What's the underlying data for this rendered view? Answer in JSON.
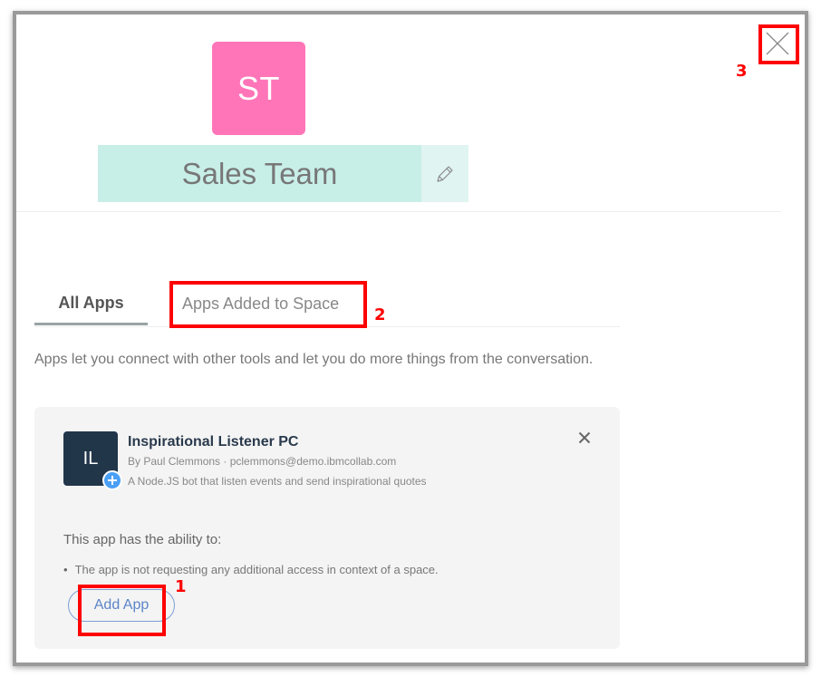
{
  "space": {
    "avatar_initials": "ST",
    "avatar_color": "#ff75b8",
    "name": "Sales Team",
    "name_field_color": "#c8eee8"
  },
  "header": {
    "edit_icon": "pencil-icon",
    "close_icon": "close-icon"
  },
  "tabs": [
    {
      "label": "All Apps",
      "active": true
    },
    {
      "label": "Apps Added to Space",
      "active": false
    }
  ],
  "intro_text": "Apps let you connect with other tools and let you do more things from the conversation.",
  "app_card": {
    "icon_initials": "IL",
    "icon_color": "#22364a",
    "badge_icon": "plus-icon",
    "badge_color": "#4a9ff5",
    "title": "Inspirational Listener PC",
    "author": "By Paul Clemmons · pclemmons@demo.ibmcollab.com",
    "description": "A Node.JS bot that listen events and send inspirational quotes",
    "dismiss_icon": "close-icon",
    "ability_heading": "This app has the ability to:",
    "abilities": [
      "The app is not requesting any additional access in context of a space."
    ],
    "add_button_label": "Add App",
    "accent_color": "#5b85c7"
  },
  "annotations": [
    {
      "number": "1",
      "target": "Add App"
    },
    {
      "number": "2",
      "target": "Apps Added to Space"
    },
    {
      "number": "3",
      "target": "close"
    }
  ]
}
